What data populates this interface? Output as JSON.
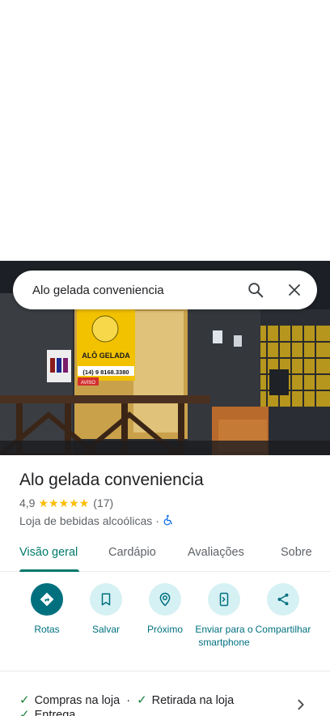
{
  "search": {
    "query": "Alo gelada conveniencia"
  },
  "hero": {
    "sign_text": "ALÔ GELADA",
    "sign_phone": "(14) 9 8168.3380",
    "sign_notice": "AVISO"
  },
  "place": {
    "title": "Alo gelada conveniencia",
    "rating": "4,9",
    "stars": 5,
    "reviews": "(17)",
    "category": "Loja de bebidas alcoólicas",
    "separator": "·"
  },
  "tabs": [
    {
      "label": "Visão geral",
      "active": true
    },
    {
      "label": "Cardápio",
      "active": false
    },
    {
      "label": "Avaliações",
      "active": false
    },
    {
      "label": "Sobre",
      "active": false
    }
  ],
  "actions": [
    {
      "label": "Rotas",
      "icon": "directions-icon"
    },
    {
      "label": "Salvar",
      "icon": "bookmark-icon"
    },
    {
      "label": "Próximo",
      "icon": "nearby-icon"
    },
    {
      "label": "Enviar para o smartphone",
      "icon": "send-to-phone-icon"
    },
    {
      "label": "Compartilhar",
      "icon": "share-icon"
    }
  ],
  "services": {
    "item1": "Compras na loja",
    "sep": "·",
    "item2": "Retirada na loja",
    "item3": "Entrega"
  },
  "colors": {
    "accent": "#00707f",
    "tab_active": "#00796b",
    "star": "#fbbc04",
    "check": "#188038"
  }
}
